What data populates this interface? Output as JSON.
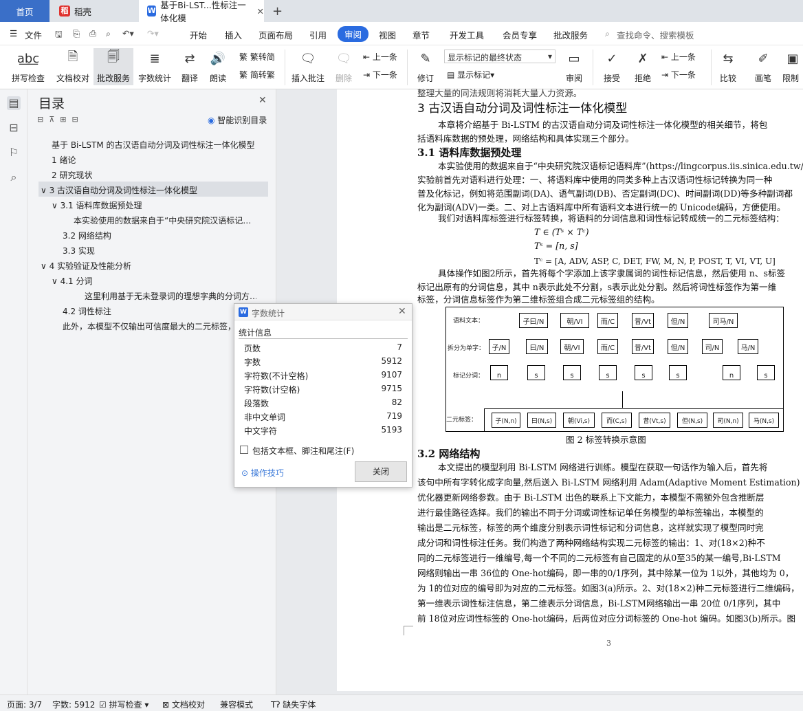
{
  "tabs": {
    "home": "首页",
    "daoke": "稻壳",
    "doc": "基于Bi-LST...性标注一体化模",
    "plus": "+"
  },
  "menu": {
    "file": "文件",
    "start": "开始",
    "insert": "插入",
    "layout": "页面布局",
    "ref": "引用",
    "review": "审阅",
    "view": "视图",
    "chapter": "章节",
    "dev": "开发工具",
    "member": "会员专享",
    "batch": "批改服务",
    "search": "查找命令、搜索模板"
  },
  "ribbon": {
    "spell": "拼写检查",
    "proof": "文档校对",
    "batch": "批改服务",
    "wordcount": "字数统计",
    "translate": "翻译",
    "read": "朗读",
    "trad": "繁转简",
    "simp": "简转繁",
    "addcomment": "插入批注",
    "delete": "删除",
    "prev": "上一条",
    "next": "下一条",
    "markup_select": "显示标记的最终状态",
    "revise": "修订",
    "showmark": "显示标记",
    "review": "审阅",
    "accept": "接受",
    "reject": "拒绝",
    "prev2": "上一条",
    "next2": "下一条",
    "compare": "比较",
    "pen": "画笔",
    "restrict": "限制"
  },
  "toc": {
    "title": "目录",
    "smart": "智能识别目录",
    "items": [
      "基于 Bi-LSTM 的古汉语自动分词及词性标注一体化模型",
      "1  绪论",
      "2  研究现状",
      "3  古汉语自动分词及词性标注一体化模型",
      "3.1 语料库数据预处理",
      "本实验使用的数据来自于“中央研究院汉语标记…",
      "3.2 网络结构",
      "3.3  实现",
      "4 实验验证及性能分析",
      "4.1 分词",
      "这里利用基于无未登录词的理想字典的分词方…",
      "4.2 词性标注",
      "此外，本模型不仅输出可信度最大的二元标签，…"
    ]
  },
  "dialog": {
    "title": "字数统计",
    "section": "统计信息",
    "rows": [
      [
        "页数",
        "7"
      ],
      [
        "字数",
        "5912"
      ],
      [
        "字符数(不计空格)",
        "9107"
      ],
      [
        "字符数(计空格)",
        "9715"
      ],
      [
        "段落数",
        "82"
      ],
      [
        "非中文单词",
        "719"
      ],
      [
        "中文字符",
        "5193"
      ]
    ],
    "checkbox": "包括文本框、脚注和尾注(F)",
    "tips": "操作技巧",
    "close": "关闭"
  },
  "doc": {
    "l0": "整理大量的同法规则将消耗大量人力资源。",
    "h2": "3  古汉语自动分词及词性标注一体化模型",
    "p1a": "本章将介绍基于 Bi-LSTM 的古汉语自动分词及词性标注一体化模型的相关细节，将包",
    "p1b": "括语料库数据的预处理，网络结构和具体实现三个部分。",
    "h31": "3.1 语料库数据预处理",
    "p2a": "本实验使用的数据来自于“中央研究院汉语标记语料库”(https://lingcorpus.iis.sinica.edu.tw/)。",
    "p2b": "实验前首先对语料进行处理：一、将语料库中使用的同类多种上古汉语词性标记转换为同一种",
    "p2c": "普及化标记，例如将范围副词(DA)、语气副词(DB)、否定副词(DC)、时间副词(DD)等多种副词都",
    "p2d": "化为副词(ADV)一类。二、对上古语料库中所有语料文本进行统一的 Unicode编码，方便使用。",
    "p3": "我们对语料库标签进行标签转换，将语料的分词信息和词性标记转成统一的二元标签结构：",
    "f1": "T ∈ (Tˢ × Tᶜ)",
    "f2": "Tˢ = [n, s]",
    "f3": "Tᶜ = [A, ADV, ASP, C, DET, FW, M, N, P, POST, T, VI, VT, U]",
    "p4a": "具体操作如图2所示，首先将每个字添加上该字隶属词的词性标记信息，然后使用 n、s标签",
    "p4b": "标记出原有的分词信息，其中 n表示此处不分割，s表示此处分割。然后将词性标签作为第一维",
    "p4c": "标签，分词信息标签作为第二维标签组合成二元标签组的结构。",
    "fig": {
      "r1": "语料文本：",
      "r2": "拆分为单字：",
      "r3": "标记分词：",
      "r4": "二元标签：",
      "words": [
        "子曰/N",
        "朝/VI",
        "而/C",
        "昔/Vt",
        "但/N",
        "司马/N"
      ],
      "chars": [
        "子/N",
        "曰/N",
        "朝/VI",
        "而/C",
        "昔/Vt",
        "但/N",
        "司/N",
        "马/N"
      ],
      "seg": [
        "n",
        "s",
        "s",
        "s",
        "s",
        "s",
        "n",
        "s"
      ],
      "pairs": [
        "子(N,n)",
        "曰(N,s)",
        "朝(Vi,s)",
        "而(C,s)",
        "昔(Vt,s)",
        "但(N,s)",
        "司(N,n)",
        "马(N,s)"
      ],
      "caption": "图 2 标签转换示意图"
    },
    "h32": "3.2 网络结构",
    "q1": "本文提出的模型利用 Bi-LSTM 网络进行训练。模型在获取一句话作为输入后，首先将",
    "q2": "该句中所有字转化成字向量,然后送入 Bi-LSTM 网络利用 Adam(Adaptive Moment Estimation)",
    "q3": "优化器更新网络参数。由于 Bi-LSTM 出色的联系上下文能力，本模型不需额外包含推断层",
    "q4": "进行最佳路径选择。我们的输出不同于分词或词性标记单任务模型的单标签输出，本模型的",
    "q5": "输出是二元标签，标签的两个维度分别表示词性标记和分词信息，这样就实现了模型同时完",
    "q6": "成分词和词性标注任务。我们构造了两种网络结构实现二元标签的输出：1、对(18×2)种不",
    "q7": "同的二元标签进行一维编号,每一个不同的二元标签有自己固定的从0至35的某一编号,Bi-LSTM",
    "q8": "网络则输出一串 36位的 One-hot编码，即一串的0/1序列，其中除某一位为 1以外，其他均为 0，",
    "q9": "为 1的位对应的编号即为对应的二元标签。如图3(a)所示。2、对(18×2)种二元标签进行二维编码，",
    "q10": "第一维表示词性标注信息，第二维表示分词信息，Bi-LSTM网络输出一串 20位 0/1序列，其中",
    "q11": "前 18位对应词性标签的 One-hot编码，后两位对应分词标签的 One-hot 编码。如图3(b)所示。图",
    "pagenum": "3"
  },
  "status": {
    "page": "页面: 3/7",
    "words": "字数: 5912",
    "spell": "拼写检查",
    "proof": "文档校对",
    "compat": "兼容模式",
    "missingfont": "缺失字体"
  }
}
